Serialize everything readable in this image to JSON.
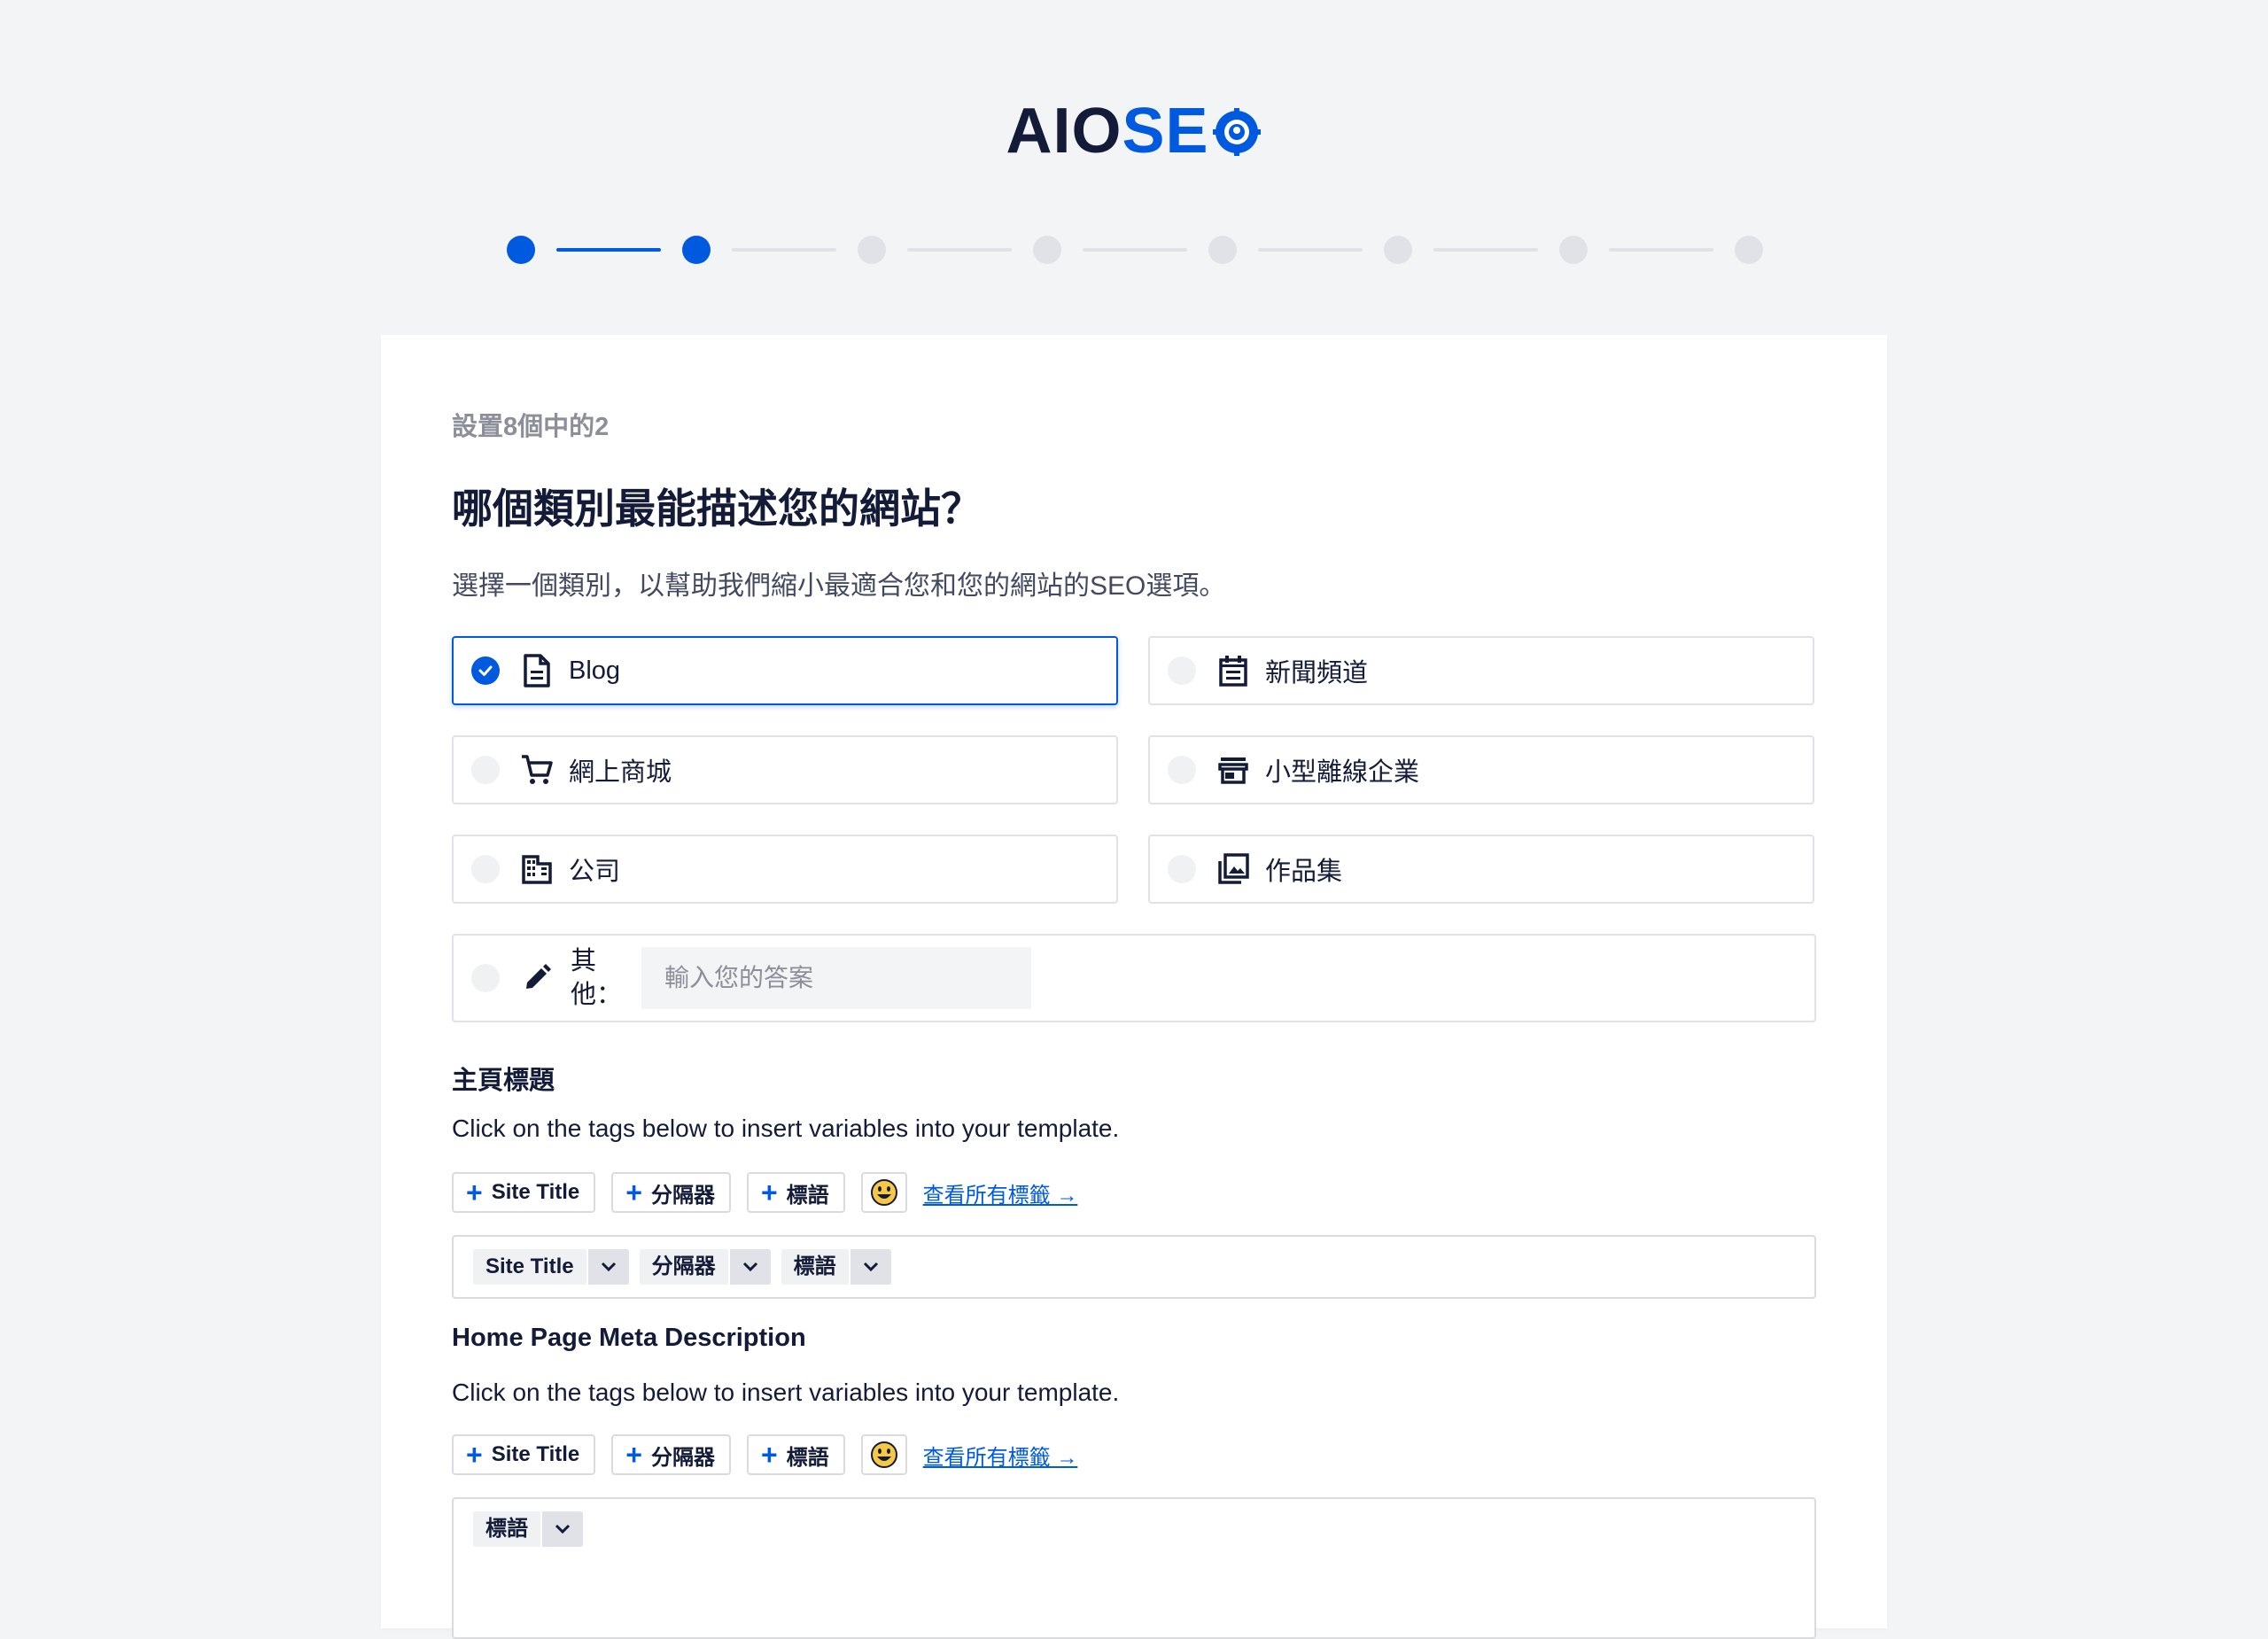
{
  "logo": {
    "part1": "AIO",
    "part2": "SE"
  },
  "stepper": {
    "total": 8,
    "current": 2
  },
  "step_label": "設置8個中的2",
  "title": "哪個類別最能描述您的網站？",
  "subtitle": "選擇一個類別，以幫助我們縮小最適合您和您的網站的SEO選項。",
  "categories": [
    {
      "label": "Blog",
      "icon": "document-icon",
      "selected": true
    },
    {
      "label": "新聞頻道",
      "icon": "calendar-icon",
      "selected": false
    },
    {
      "label": "網上商城",
      "icon": "cart-icon",
      "selected": false
    },
    {
      "label": "小型離線企業",
      "icon": "store-icon",
      "selected": false
    },
    {
      "label": "公司",
      "icon": "building-icon",
      "selected": false
    },
    {
      "label": "作品集",
      "icon": "gallery-icon",
      "selected": false
    }
  ],
  "other": {
    "label_line1": "其",
    "label_line2": "他：",
    "placeholder": "輸入您的答案"
  },
  "home_title": {
    "title": "主頁標題",
    "help": "Click on the tags below to insert variables into your template.",
    "tag_buttons": [
      "Site Title",
      "分隔器",
      "標語"
    ],
    "view_all": "查看所有標籤 →",
    "chips": [
      "Site Title",
      "分隔器",
      "標語"
    ]
  },
  "meta_description": {
    "title": "Home Page Meta Description",
    "help": "Click on the tags below to insert variables into your template.",
    "tag_buttons": [
      "Site Title",
      "分隔器",
      "標語"
    ],
    "view_all": "查看所有標籤 →",
    "chips": [
      "標語"
    ]
  },
  "colors": {
    "accent": "#005ae0",
    "text": "#141b38",
    "muted": "#8c8f9a",
    "border": "#e0e2e8"
  }
}
